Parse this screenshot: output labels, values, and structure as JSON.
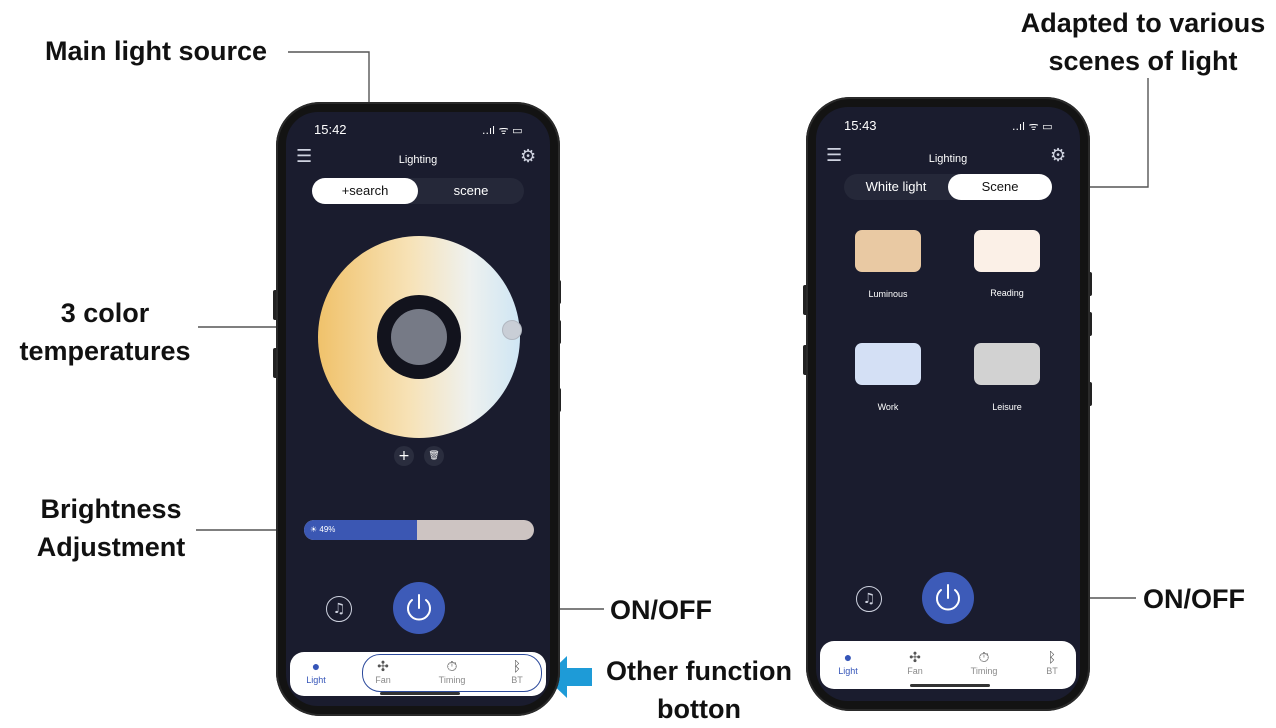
{
  "callouts": {
    "main_light_source": "Main light source",
    "color_temps_line1": "3 color",
    "color_temps_line2": "temperatures",
    "brightness_line1": "Brightness",
    "brightness_line2": "Adjustment",
    "on_off_left": "ON/OFF",
    "other_function_line1": "Other function",
    "other_function_line2": "botton",
    "adapted_line1": "Adapted to various",
    "adapted_line2": "scenes of light",
    "on_off_right": "ON/OFF"
  },
  "phone_left": {
    "time": "15:42",
    "status_icons": "..ıl ᯤ ▭",
    "title": "Lighting",
    "segments": [
      "+search",
      "scene"
    ],
    "active_segment": 0,
    "brightness": {
      "label": "☀ 49%",
      "value": 49,
      "fill_color": "#3b57b3",
      "track_color": "#cdc4c2"
    },
    "wheel_buttons": [
      "+",
      "🗑"
    ],
    "tabs": [
      {
        "icon": "light-bulb-icon",
        "glyph": "💡",
        "label": "Light",
        "active": true
      },
      {
        "icon": "fan-icon",
        "glyph": "✣",
        "label": "Fan",
        "active": false
      },
      {
        "icon": "timer-icon",
        "glyph": "⏱",
        "label": "Timing",
        "active": false
      },
      {
        "icon": "bluetooth-icon",
        "glyph": "ᛒ",
        "label": "BT",
        "active": false
      }
    ]
  },
  "phone_right": {
    "time": "15:43",
    "status_icons": "..ıl ᯤ ▭",
    "title": "Lighting",
    "segments": [
      "White light",
      "Scene"
    ],
    "active_segment": 1,
    "scenes": [
      {
        "label": "Luminous",
        "color": "#e9c9a3"
      },
      {
        "label": "Reading",
        "color": "#fbf0e7"
      },
      {
        "label": "Work",
        "color": "#d4e0f5"
      },
      {
        "label": "Leisure",
        "color": "#d2d2d2"
      }
    ],
    "tabs": [
      {
        "icon": "light-bulb-icon",
        "glyph": "💡",
        "label": "Light",
        "active": true
      },
      {
        "icon": "fan-icon",
        "glyph": "✣",
        "label": "Fan",
        "active": false
      },
      {
        "icon": "timer-icon",
        "glyph": "⏱",
        "label": "Timing",
        "active": false
      },
      {
        "icon": "bluetooth-icon",
        "glyph": "ᛒ",
        "label": "BT",
        "active": false
      }
    ]
  },
  "colors": {
    "accent": "#3d5bb8",
    "screen_bg": "#1a1c2e",
    "callout_arrow": "#1e9bd7"
  }
}
